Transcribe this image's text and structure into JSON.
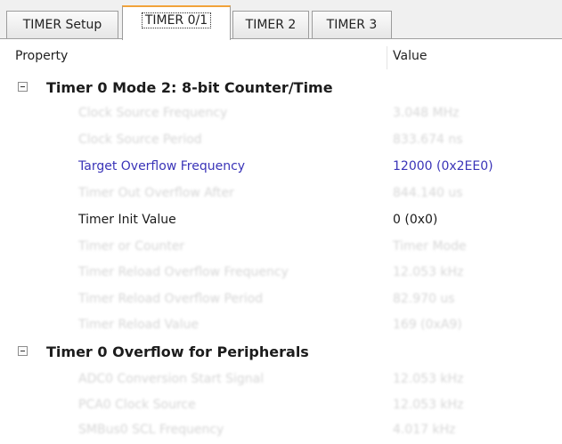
{
  "tabs": [
    {
      "label": "TIMER Setup"
    },
    {
      "label": "TIMER 0/1"
    },
    {
      "label": "TIMER 2"
    },
    {
      "label": "TIMER 3"
    }
  ],
  "active_tab": "TIMER 0/1",
  "header": {
    "property": "Property",
    "value": "Value"
  },
  "groups": [
    {
      "label": "Timer 0 Mode 2: 8-bit Counter/Time",
      "rows": [
        {
          "name": "Clock Source Frequency",
          "value": "3.048 MHz",
          "state": "disabled"
        },
        {
          "name": "Clock Source Period",
          "value": "833.674 ns",
          "state": "disabled"
        },
        {
          "name": "Target Overflow Frequency",
          "value": "12000 (0x2EE0)",
          "state": "editable"
        },
        {
          "name": "Timer Out Overflow After",
          "value": "844.140 us",
          "state": "disabled"
        },
        {
          "name": "Timer Init Value",
          "value": "0 (0x0)",
          "state": "normal"
        },
        {
          "name": "Timer or Counter",
          "value": "Timer Mode",
          "state": "disabled"
        },
        {
          "name": "Timer Reload Overflow Frequency",
          "value": "12.053 kHz",
          "state": "disabled"
        },
        {
          "name": "Timer Reload Overflow Period",
          "value": "82.970 us",
          "state": "disabled"
        },
        {
          "name": "Timer Reload Value",
          "value": "169 (0xA9)",
          "state": "disabled"
        }
      ]
    },
    {
      "label": "Timer 0 Overflow for Peripherals",
      "rows": [
        {
          "name": "ADC0 Conversion Start Signal",
          "value": "12.053 kHz",
          "state": "disabled"
        },
        {
          "name": "PCA0 Clock Source",
          "value": "12.053 kHz",
          "state": "disabled"
        },
        {
          "name": "SMBus0 SCL Frequency",
          "value": "4.017 kHz",
          "state": "disabled"
        }
      ]
    }
  ],
  "colors": {
    "active_tab_accent": "#f1a33a",
    "editable_text": "#3a34b8",
    "disabled_text": "#d6d6d6"
  }
}
